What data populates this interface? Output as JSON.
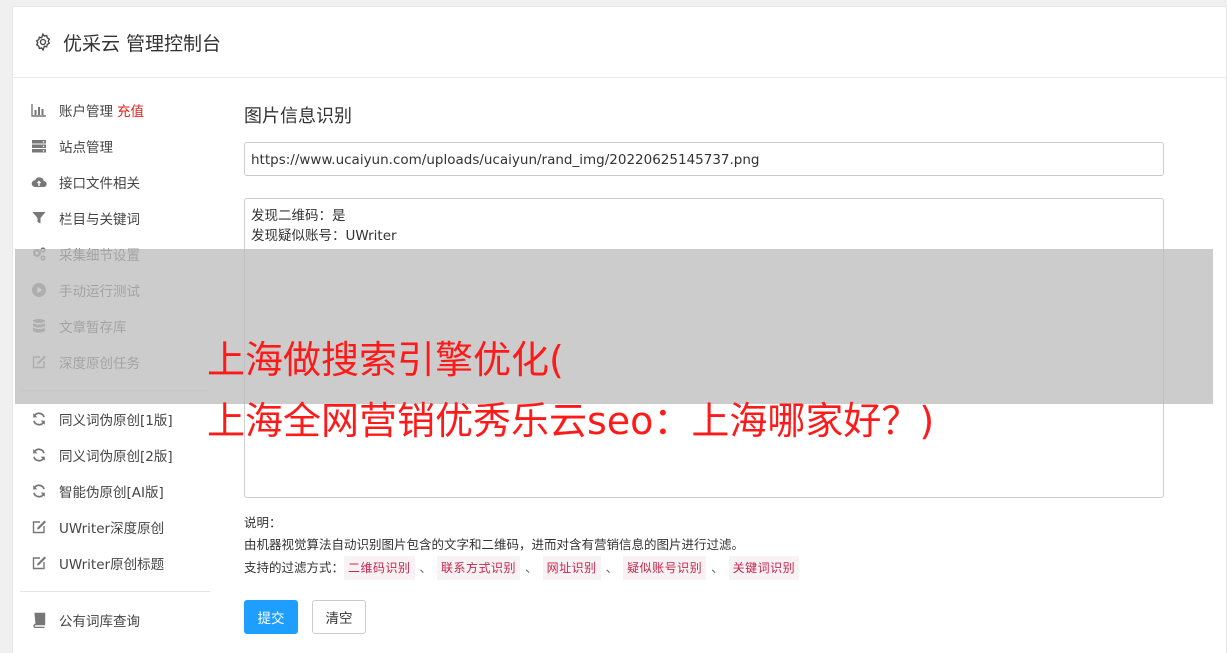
{
  "header": {
    "title": "优采云 管理控制台"
  },
  "sidebar": {
    "group1": [
      {
        "label": "账户管理",
        "extra": "充值",
        "icon": "bar-chart-icon"
      },
      {
        "label": "站点管理",
        "icon": "server-icon"
      },
      {
        "label": "接口文件相关",
        "icon": "cloud-upload-icon"
      },
      {
        "label": "栏目与关键词",
        "icon": "filter-icon"
      },
      {
        "label": "采集细节设置",
        "icon": "gears-icon"
      },
      {
        "label": "手动运行测试",
        "icon": "play-circle-icon"
      },
      {
        "label": "文章暂存库",
        "icon": "database-icon"
      },
      {
        "label": "深度原创任务",
        "icon": "edit-icon"
      }
    ],
    "group2": [
      {
        "label": "同义词伪原创[1版]",
        "icon": "refresh-icon"
      },
      {
        "label": "同义词伪原创[2版]",
        "icon": "refresh-icon"
      },
      {
        "label": "智能伪原创[AI版]",
        "icon": "refresh-icon"
      },
      {
        "label": "UWriter深度原创",
        "icon": "edit-icon"
      },
      {
        "label": "UWriter原创标题",
        "icon": "edit-icon"
      }
    ],
    "group3": [
      {
        "label": "公有词库查询",
        "icon": "book-icon"
      }
    ]
  },
  "main": {
    "title": "图片信息识别",
    "url_value": "https://www.ucaiyun.com/uploads/ucaiyun/rand_img/20220625145737.png",
    "result_lines": [
      "发现二维码：是",
      "发现疑似账号：UWriter"
    ],
    "notes": {
      "heading": "说明：",
      "desc": "由机器视觉算法自动识别图片包含的文字和二维码，进而对含有营销信息的图片进行过滤。",
      "filter_label": "支持的过滤方式：",
      "filters": [
        "二维码识别",
        "联系方式识别",
        "网址识别",
        "疑似账号识别",
        "关键词识别"
      ],
      "separator": "、"
    },
    "buttons": {
      "submit": "提交",
      "clear": "清空"
    }
  },
  "overlay": {
    "line1": "上海做搜索引擎优化(",
    "line2": "上海全网营销优秀乐云seo：上海哪家好？)"
  }
}
